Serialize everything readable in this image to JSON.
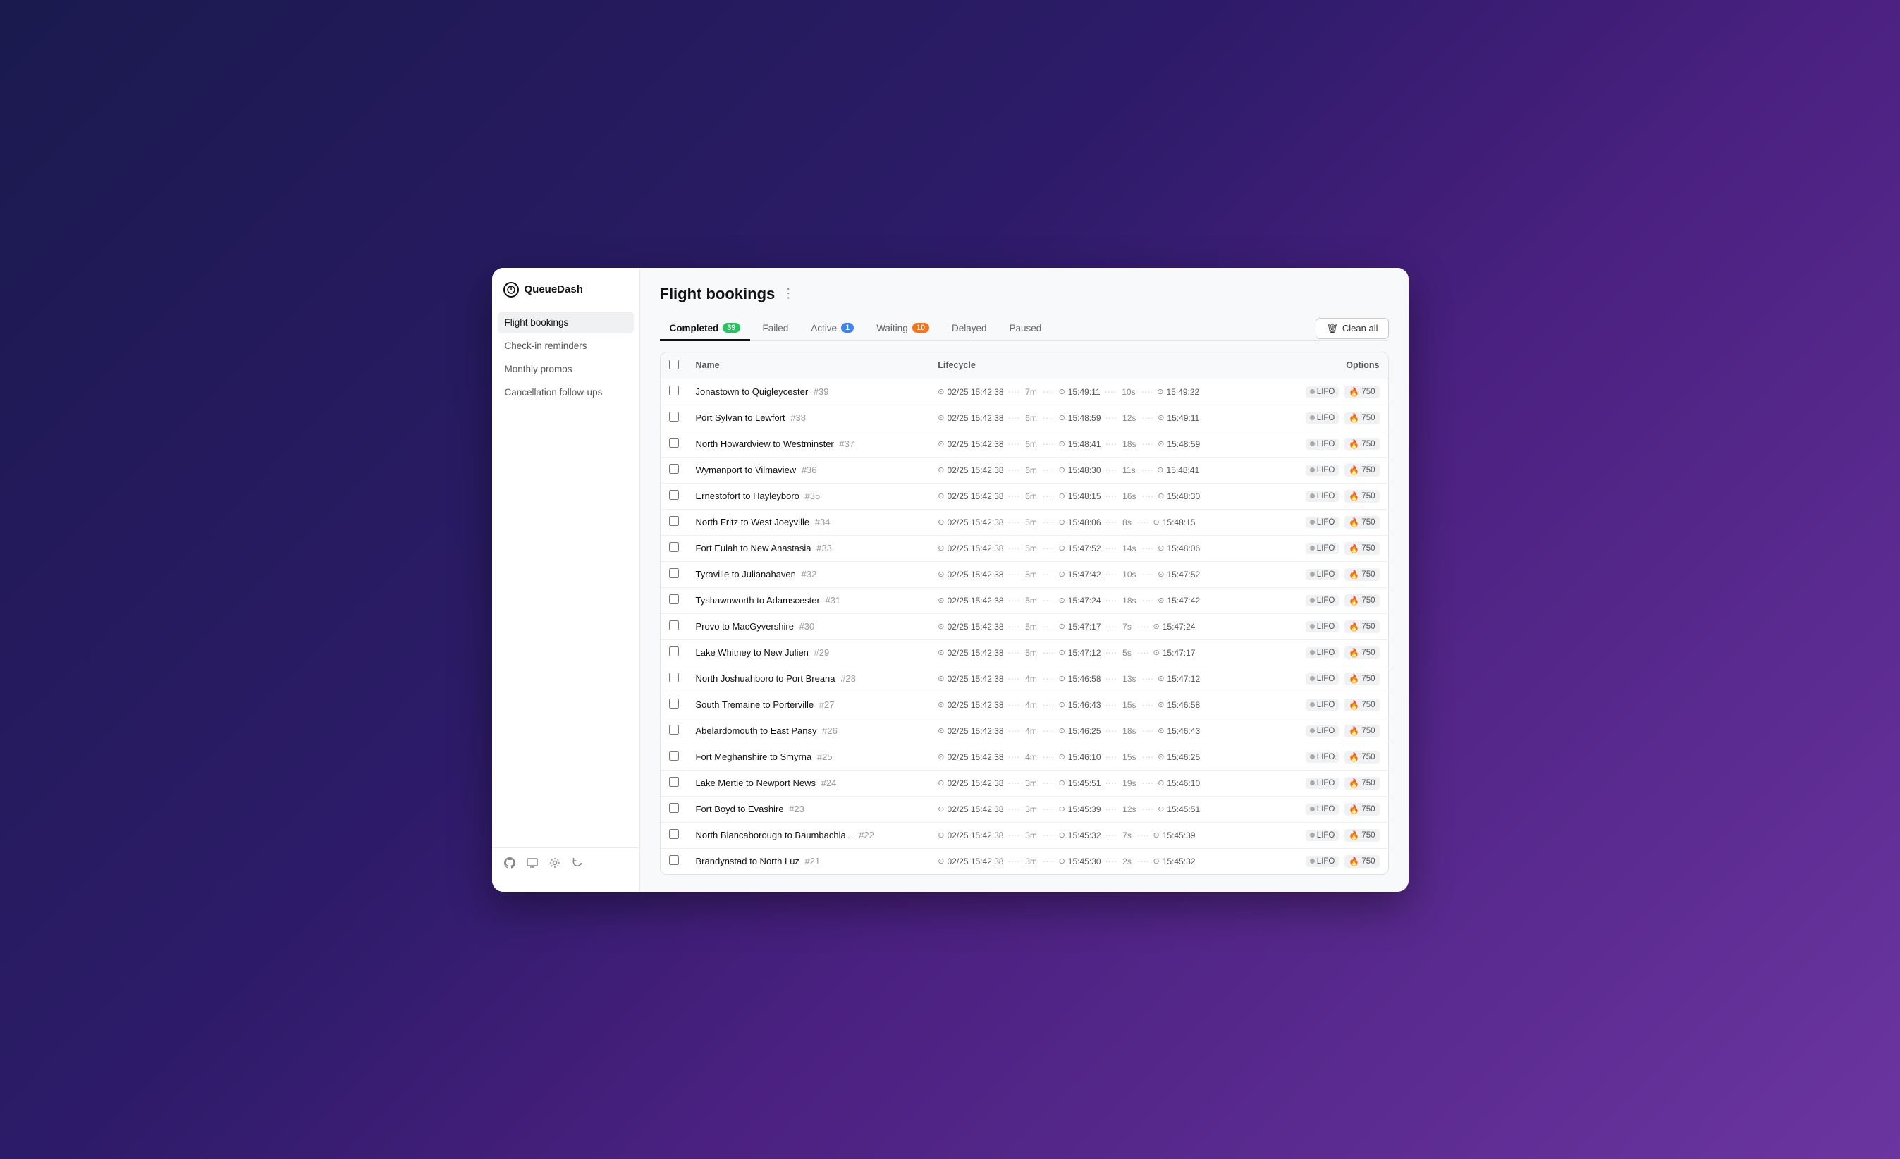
{
  "app": {
    "name": "QueueDash"
  },
  "sidebar": {
    "items": [
      {
        "id": "flight-bookings",
        "label": "Flight bookings",
        "active": true
      },
      {
        "id": "check-in-reminders",
        "label": "Check-in reminders",
        "active": false
      },
      {
        "id": "monthly-promos",
        "label": "Monthly promos",
        "active": false
      },
      {
        "id": "cancellation-follow-ups",
        "label": "Cancellation follow-ups",
        "active": false
      }
    ],
    "footer_icons": [
      "github-icon",
      "monitor-icon",
      "settings-icon",
      "refresh-icon"
    ]
  },
  "header": {
    "title": "Flight bookings",
    "menu_label": "⋮"
  },
  "tabs": [
    {
      "id": "completed",
      "label": "Completed",
      "badge": "39",
      "badge_color": "green",
      "active": true
    },
    {
      "id": "failed",
      "label": "Failed",
      "badge": null,
      "active": false
    },
    {
      "id": "active",
      "label": "Active",
      "badge": "1",
      "badge_color": "blue",
      "active": false
    },
    {
      "id": "waiting",
      "label": "Waiting",
      "badge": "10",
      "badge_color": "orange",
      "active": false
    },
    {
      "id": "delayed",
      "label": "Delayed",
      "badge": null,
      "active": false
    },
    {
      "id": "paused",
      "label": "Paused",
      "badge": null,
      "active": false
    }
  ],
  "clean_all_button": "Clean all",
  "table": {
    "columns": [
      "",
      "Name",
      "Lifecycle",
      "",
      "Options"
    ],
    "rows": [
      {
        "name": "Jonastown to Quigleycester",
        "id": "#39",
        "date": "02/25 15:42:38",
        "dur1": "7m",
        "time1": "15:49:11",
        "dur2": "10s",
        "time2": "15:49:22",
        "lifo": "LIFO",
        "priority": "750"
      },
      {
        "name": "Port Sylvan to Lewfort",
        "id": "#38",
        "date": "02/25 15:42:38",
        "dur1": "6m",
        "time1": "15:48:59",
        "dur2": "12s",
        "time2": "15:49:11",
        "lifo": "LIFO",
        "priority": "750"
      },
      {
        "name": "North Howardview to Westminster",
        "id": "#37",
        "date": "02/25 15:42:38",
        "dur1": "6m",
        "time1": "15:48:41",
        "dur2": "18s",
        "time2": "15:48:59",
        "lifo": "LIFO",
        "priority": "750"
      },
      {
        "name": "Wymanport to Vilmaview",
        "id": "#36",
        "date": "02/25 15:42:38",
        "dur1": "6m",
        "time1": "15:48:30",
        "dur2": "11s",
        "time2": "15:48:41",
        "lifo": "LIFO",
        "priority": "750"
      },
      {
        "name": "Ernestofort to Hayleyboro",
        "id": "#35",
        "date": "02/25 15:42:38",
        "dur1": "6m",
        "time1": "15:48:15",
        "dur2": "16s",
        "time2": "15:48:30",
        "lifo": "LIFO",
        "priority": "750"
      },
      {
        "name": "North Fritz to West Joeyville",
        "id": "#34",
        "date": "02/25 15:42:38",
        "dur1": "5m",
        "time1": "15:48:06",
        "dur2": "8s",
        "time2": "15:48:15",
        "lifo": "LIFO",
        "priority": "750"
      },
      {
        "name": "Fort Eulah to New Anastasia",
        "id": "#33",
        "date": "02/25 15:42:38",
        "dur1": "5m",
        "time1": "15:47:52",
        "dur2": "14s",
        "time2": "15:48:06",
        "lifo": "LIFO",
        "priority": "750"
      },
      {
        "name": "Tyraville to Julianahaven",
        "id": "#32",
        "date": "02/25 15:42:38",
        "dur1": "5m",
        "time1": "15:47:42",
        "dur2": "10s",
        "time2": "15:47:52",
        "lifo": "LIFO",
        "priority": "750"
      },
      {
        "name": "Tyshawnworth to Adamscester",
        "id": "#31",
        "date": "02/25 15:42:38",
        "dur1": "5m",
        "time1": "15:47:24",
        "dur2": "18s",
        "time2": "15:47:42",
        "lifo": "LIFO",
        "priority": "750"
      },
      {
        "name": "Provo to MacGyvershire",
        "id": "#30",
        "date": "02/25 15:42:38",
        "dur1": "5m",
        "time1": "15:47:17",
        "dur2": "7s",
        "time2": "15:47:24",
        "lifo": "LIFO",
        "priority": "750"
      },
      {
        "name": "Lake Whitney to New Julien",
        "id": "#29",
        "date": "02/25 15:42:38",
        "dur1": "5m",
        "time1": "15:47:12",
        "dur2": "5s",
        "time2": "15:47:17",
        "lifo": "LIFO",
        "priority": "750"
      },
      {
        "name": "North Joshuahboro to Port Breana",
        "id": "#28",
        "date": "02/25 15:42:38",
        "dur1": "4m",
        "time1": "15:46:58",
        "dur2": "13s",
        "time2": "15:47:12",
        "lifo": "LIFO",
        "priority": "750"
      },
      {
        "name": "South Tremaine to Porterville",
        "id": "#27",
        "date": "02/25 15:42:38",
        "dur1": "4m",
        "time1": "15:46:43",
        "dur2": "15s",
        "time2": "15:46:58",
        "lifo": "LIFO",
        "priority": "750"
      },
      {
        "name": "Abelardomouth to East Pansy",
        "id": "#26",
        "date": "02/25 15:42:38",
        "dur1": "4m",
        "time1": "15:46:25",
        "dur2": "18s",
        "time2": "15:46:43",
        "lifo": "LIFO",
        "priority": "750"
      },
      {
        "name": "Fort Meghanshire to Smyrna",
        "id": "#25",
        "date": "02/25 15:42:38",
        "dur1": "4m",
        "time1": "15:46:10",
        "dur2": "15s",
        "time2": "15:46:25",
        "lifo": "LIFO",
        "priority": "750"
      },
      {
        "name": "Lake Mertie to Newport News",
        "id": "#24",
        "date": "02/25 15:42:38",
        "dur1": "3m",
        "time1": "15:45:51",
        "dur2": "19s",
        "time2": "15:46:10",
        "lifo": "LIFO",
        "priority": "750"
      },
      {
        "name": "Fort Boyd to Evashire",
        "id": "#23",
        "date": "02/25 15:42:38",
        "dur1": "3m",
        "time1": "15:45:39",
        "dur2": "12s",
        "time2": "15:45:51",
        "lifo": "LIFO",
        "priority": "750"
      },
      {
        "name": "North Blancaborough to Baumbachla...",
        "id": "#22",
        "date": "02/25 15:42:38",
        "dur1": "3m",
        "time1": "15:45:32",
        "dur2": "7s",
        "time2": "15:45:39",
        "lifo": "LIFO",
        "priority": "750"
      },
      {
        "name": "Brandynstad to North Luz",
        "id": "#21",
        "date": "02/25 15:42:38",
        "dur1": "3m",
        "time1": "15:45:30",
        "dur2": "2s",
        "time2": "15:45:32",
        "lifo": "LIFO",
        "priority": "750"
      }
    ]
  }
}
